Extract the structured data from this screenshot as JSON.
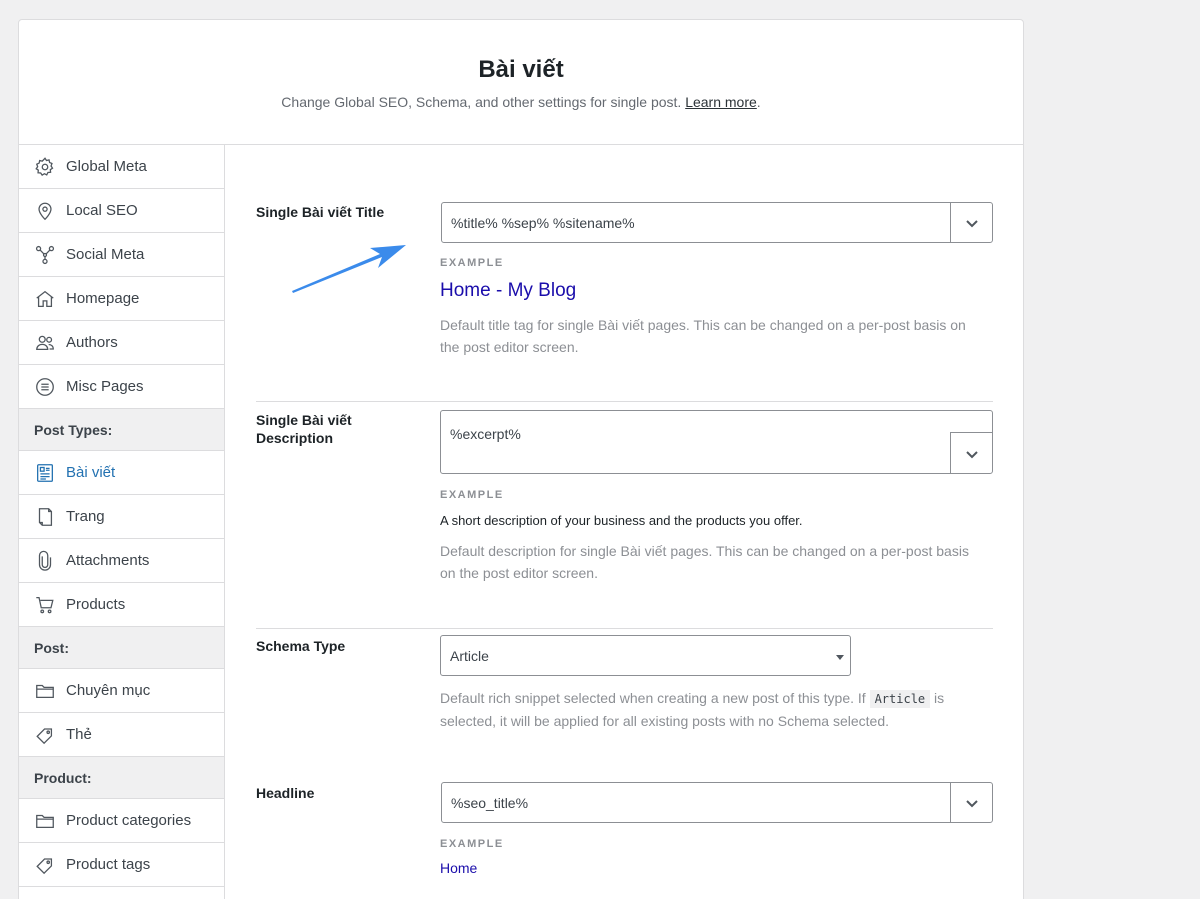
{
  "header": {
    "title": "Bài viết",
    "subtitle": "Change Global SEO, Schema, and other settings for single post.",
    "learn_more": "Learn more",
    "period": "."
  },
  "sidebar": {
    "items_top": [
      {
        "label": "Global Meta",
        "icon": "gear-icon"
      },
      {
        "label": "Local SEO",
        "icon": "map-pin-icon"
      },
      {
        "label": "Social Meta",
        "icon": "share-nodes-icon"
      },
      {
        "label": "Homepage",
        "icon": "home-icon"
      },
      {
        "label": "Authors",
        "icon": "users-icon"
      },
      {
        "label": "Misc Pages",
        "icon": "list-circle-icon"
      }
    ],
    "group_post_types": "Post Types:",
    "post_types": [
      {
        "label": "Bài viết",
        "icon": "post-icon"
      },
      {
        "label": "Trang",
        "icon": "page-icon"
      },
      {
        "label": "Attachments",
        "icon": "paperclip-icon"
      },
      {
        "label": "Products",
        "icon": "cart-icon"
      }
    ],
    "group_post": "Post:",
    "post_tax": [
      {
        "label": "Chuyên mục",
        "icon": "folder-icon"
      },
      {
        "label": "Thẻ",
        "icon": "tag-icon"
      }
    ],
    "group_product": "Product:",
    "product_tax": [
      {
        "label": "Product categories",
        "icon": "folder-icon"
      },
      {
        "label": "Product tags",
        "icon": "tag-icon"
      }
    ],
    "accent": "#2271b1"
  },
  "title_row": {
    "label": "Single Bài viết Title",
    "value": "%title% %sep% %sitename%",
    "example_label": "EXAMPLE",
    "example": "Home - My Blog",
    "help_line1": "Default title tag for single Bài viết pages. This can be changed on a per-post basis on",
    "help_line2": "the post editor screen."
  },
  "desc_row": {
    "label_line1": "Single Bài viết",
    "label_line2": "Description",
    "value": "%excerpt%",
    "example_label": "EXAMPLE",
    "example": "A short description of your business and the products you offer.",
    "help_line1": "Default description for single Bài viết pages. This can be changed on a per-post basis",
    "help_line2": "on the post editor screen."
  },
  "schema_row": {
    "label": "Schema Type",
    "value": "Article",
    "help_pre": "Default rich snippet selected when creating a new post of this type. If",
    "help_code": "Article",
    "help_post": "is",
    "help_line2": "selected, it will be applied for all existing posts with no Schema selected."
  },
  "headline_row": {
    "label": "Headline",
    "value": "%seo_title%",
    "example_label": "EXAMPLE",
    "example": "Home"
  },
  "colors": {
    "arrow": "#3b8beb",
    "link": "#1a0dab"
  }
}
